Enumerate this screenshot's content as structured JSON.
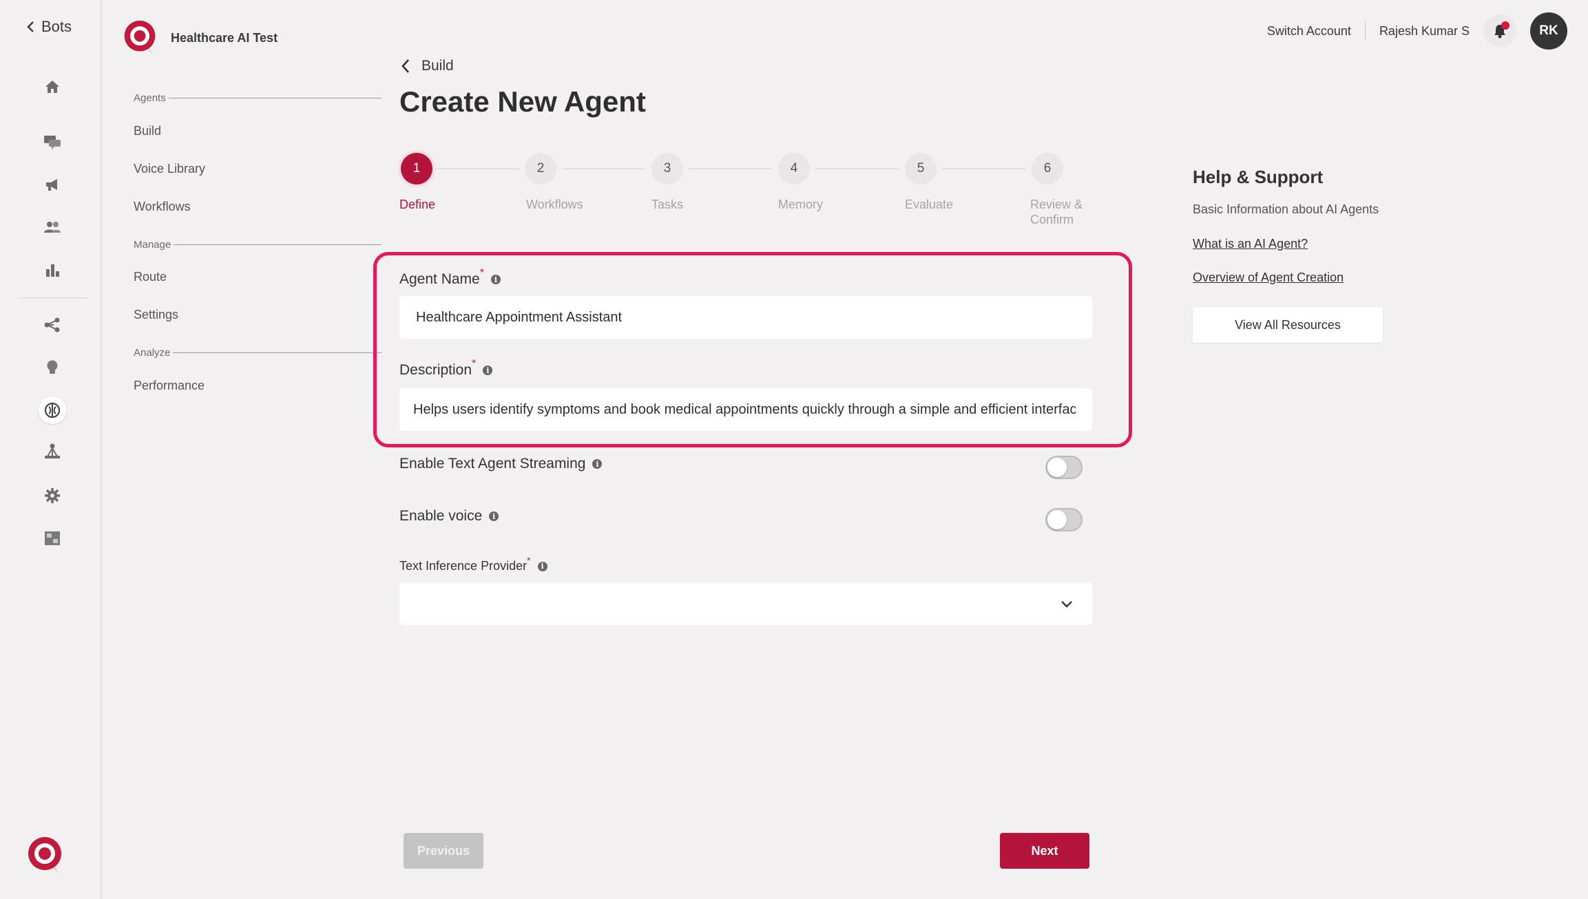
{
  "nav": {
    "back_label": "Bots",
    "workspace_name": "Healthcare AI Test",
    "sections": [
      {
        "title": "Agents",
        "items": [
          "Build",
          "Voice Library",
          "Workflows"
        ]
      },
      {
        "title": "Manage",
        "items": [
          "Route",
          "Settings"
        ]
      },
      {
        "title": "Analyze",
        "items": [
          "Performance"
        ]
      }
    ],
    "rail_icons": [
      "home-icon",
      "chat-icon",
      "megaphone-icon",
      "users-icon",
      "bar-chart-icon",
      "share-nodes-icon",
      "lightbulb-icon",
      "brain-icon",
      "hierarchy-icon",
      "gear-icon",
      "integration-icon"
    ]
  },
  "header": {
    "switch_account": "Switch Account",
    "user_name": "Rajesh Kumar S",
    "avatar_initials": "RK"
  },
  "page": {
    "breadcrumb": "Build",
    "title": "Create New Agent"
  },
  "stepper": {
    "steps": [
      {
        "number": "1",
        "label": "Define",
        "active": true
      },
      {
        "number": "2",
        "label": "Workflows",
        "active": false
      },
      {
        "number": "3",
        "label": "Tasks",
        "active": false
      },
      {
        "number": "4",
        "label": "Memory",
        "active": false
      },
      {
        "number": "5",
        "label": "Evaluate",
        "active": false
      },
      {
        "number": "6",
        "label": "Review & Confirm",
        "active": false
      }
    ]
  },
  "form": {
    "agent_name_label": "Agent Name",
    "agent_name_value": "Healthcare Appointment Assistant",
    "description_label": "Description",
    "description_value": "Helps users identify symptoms and book medical appointments quickly through a simple and efficient interface",
    "streaming_label": "Enable Text Agent Streaming",
    "streaming_enabled": false,
    "voice_label": "Enable voice",
    "voice_enabled": false,
    "provider_label": "Text Inference Provider",
    "provider_value": "",
    "required_mark": "*",
    "info_mark": "i"
  },
  "buttons": {
    "previous": "Previous",
    "next": "Next"
  },
  "help": {
    "title": "Help & Support",
    "subtitle": "Basic Information about AI Agents",
    "link_1": "What is an AI Agent?",
    "link_2": "Overview of Agent Creation",
    "button": "View All Resources"
  },
  "colors": {
    "brand": "#b4143a",
    "highlight": "#e3195a",
    "background": "#f2f0f1"
  }
}
